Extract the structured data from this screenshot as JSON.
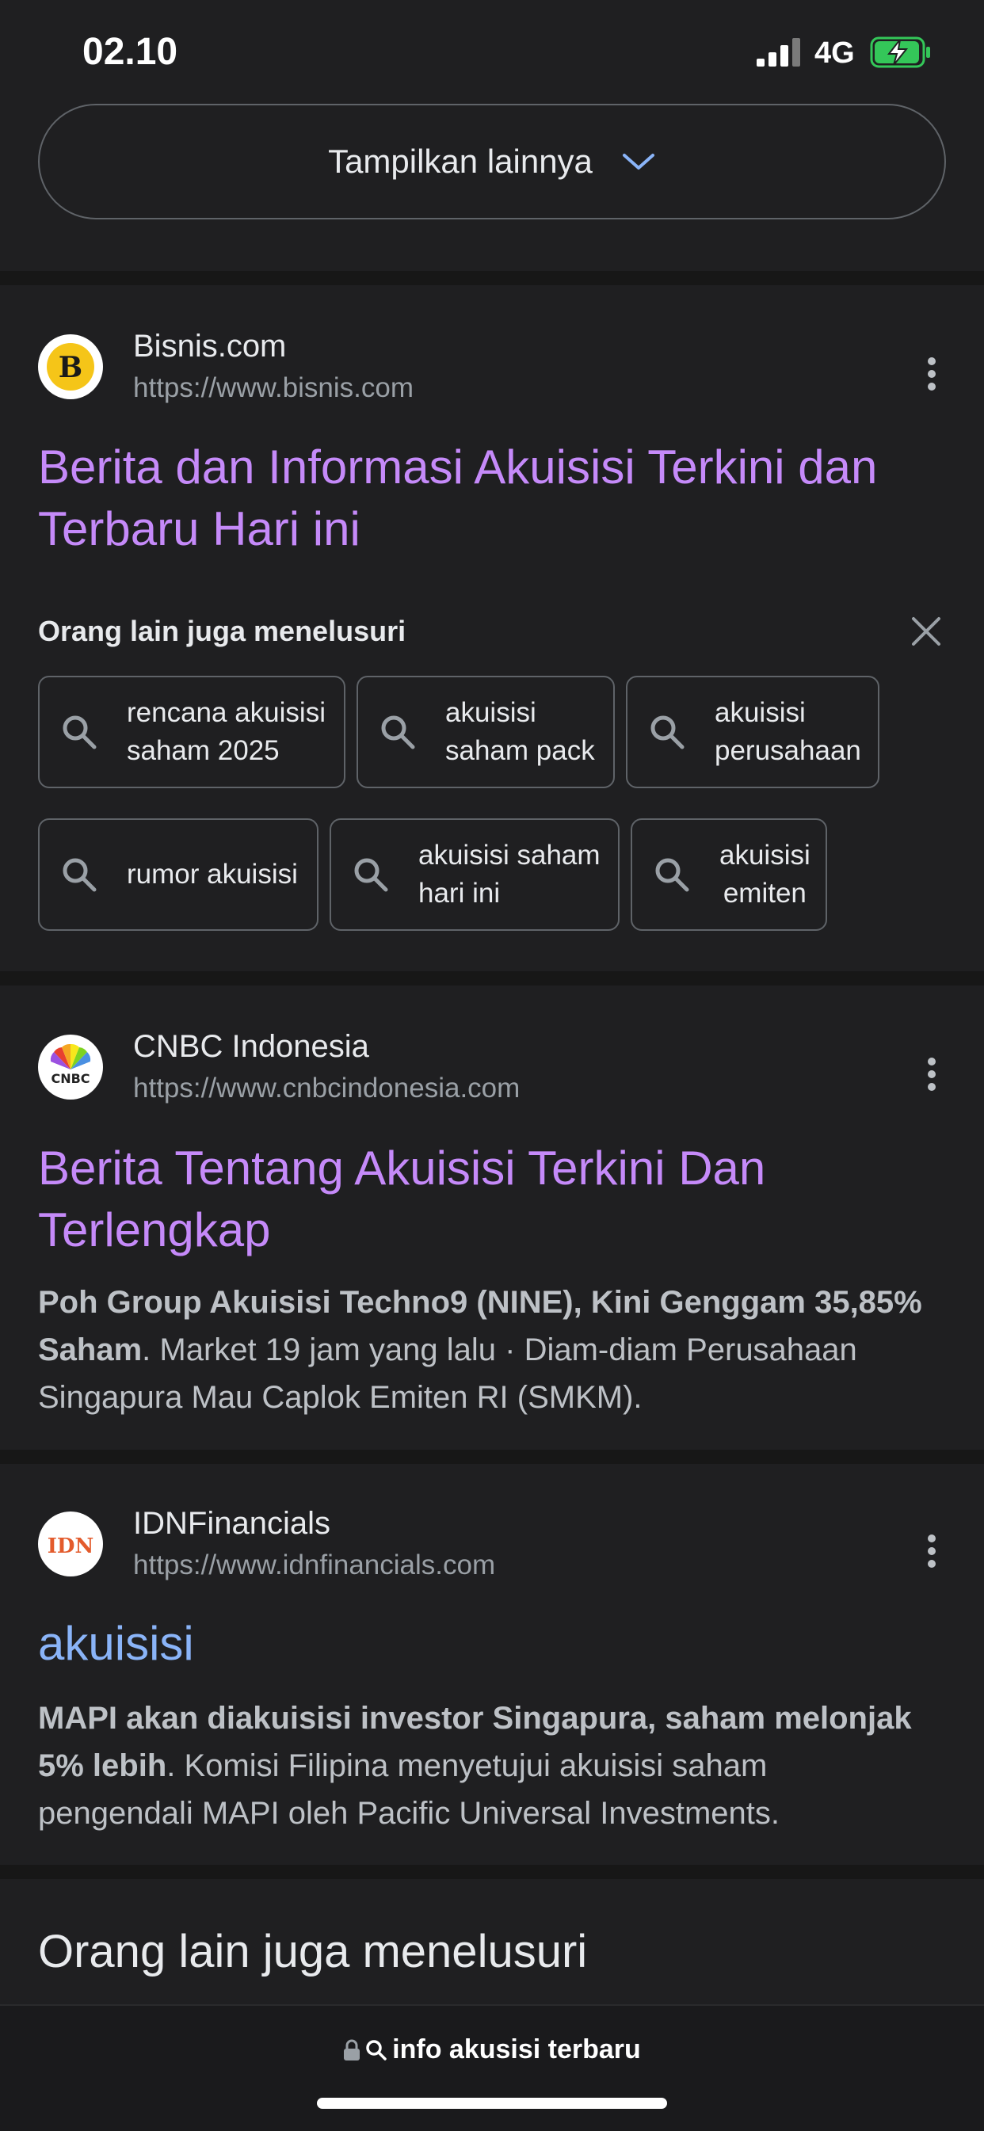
{
  "status": {
    "time": "02.10",
    "network": "4G"
  },
  "show_more": {
    "label": "Tampilkan lainnya"
  },
  "results": [
    {
      "site": "Bisnis.com",
      "url": "https://www.bisnis.com",
      "favicon_letter": "B",
      "title_line1": "Berita dan Informasi Akuisisi Terkini dan",
      "title_line2": "Terbaru Hari ini"
    },
    {
      "site": "CNBC Indonesia",
      "url": "https://www.cnbcindonesia.com",
      "favicon_text": "CNBC",
      "title_line1": "Berita Tentang Akuisisi Terkini Dan",
      "title_line2": "Terlengkap",
      "snippet_bold1": "Poh Group Akuisisi Techno9 (NINE), Kini Genggam 35,85%",
      "snippet_bold2": "Saham",
      "snippet_rest1": ". Market 19 jam yang lalu · Diam-diam Perusahaan",
      "snippet_rest2": "Singapura Mau Caplok Emiten RI (SMKM)."
    },
    {
      "site": "IDNFinancials",
      "url": "https://www.idnfinancials.com",
      "favicon_text": "IDN",
      "title_line1": "akuisisi",
      "snippet_bold1": "MAPI akan diakuisisi investor Singapura, saham melonjak",
      "snippet_bold2": "5% lebih",
      "snippet_rest1": ". Komisi Filipina menyetujui akuisisi saham",
      "snippet_rest2": "pengendali MAPI oleh Pacific Universal Investments."
    }
  ],
  "people_also_search": {
    "title": "Orang lain juga menelusuri",
    "chips": [
      {
        "line1": "rencana akuisisi",
        "line2": "saham 2025"
      },
      {
        "line1": "akuisisi",
        "line2": "saham pack"
      },
      {
        "line1": "akuisisi",
        "line2": "perusahaan"
      },
      {
        "line1": "rumor akuisisi",
        "line2": ""
      },
      {
        "line1": "akuisisi saham",
        "line2": "hari ini"
      },
      {
        "line1": "akuisisi",
        "line2": "emiten"
      }
    ]
  },
  "section_heading": "Orang lain juga menelusuri",
  "bottom": {
    "query": "info akusisi terbaru"
  },
  "colors": {
    "visited_link": "#c58af9",
    "link": "#8ab4f8",
    "battery_charge": "#34c759"
  }
}
